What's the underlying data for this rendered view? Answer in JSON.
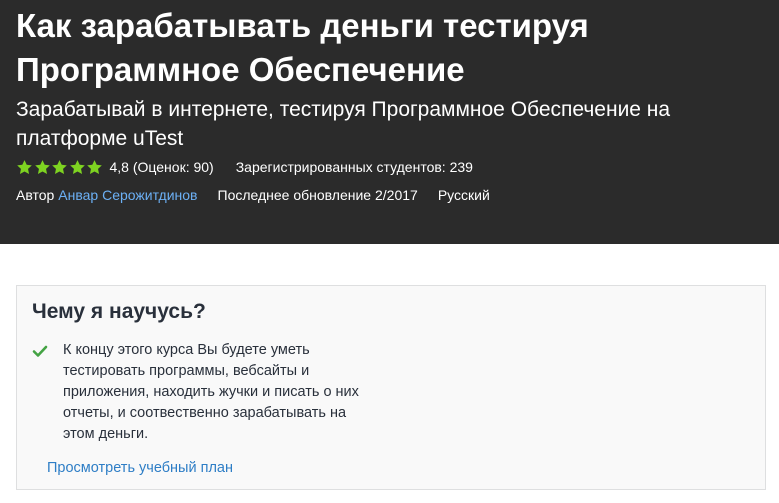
{
  "course": {
    "title": "Как зарабатывать деньги тестируя Программное Обеспечение",
    "subtitle": "Зарабатывай в интернете, тестируя Программное Обеспечение на платформе uTest",
    "rating": 4.8,
    "rating_text": "4,8 (Оценок: 90)",
    "star_color": "#7ed321",
    "stars_count": 5,
    "enrolled": "Зарегистрированных студентов: 239",
    "author_label": "Автор",
    "author_name": "Анвар Серожитдинов",
    "last_updated": "Последнее обновление 2/2017",
    "language": "Русский"
  },
  "learn": {
    "heading": "Чему я научусь?",
    "check_icon": "check-icon",
    "items": [
      "К концу этого курса Вы будете уметь тестировать программы, вебсайты и приложения, находить жучки и писать о них отчеты, и соотвественно зарабатывать на этом деньги."
    ],
    "curriculum_link": "Просмотреть учебный план"
  },
  "colors": {
    "hero_bg": "#2b2b2b",
    "link_light": "#6cb0f5",
    "link": "#2e7ec6",
    "check": "#44a344"
  }
}
